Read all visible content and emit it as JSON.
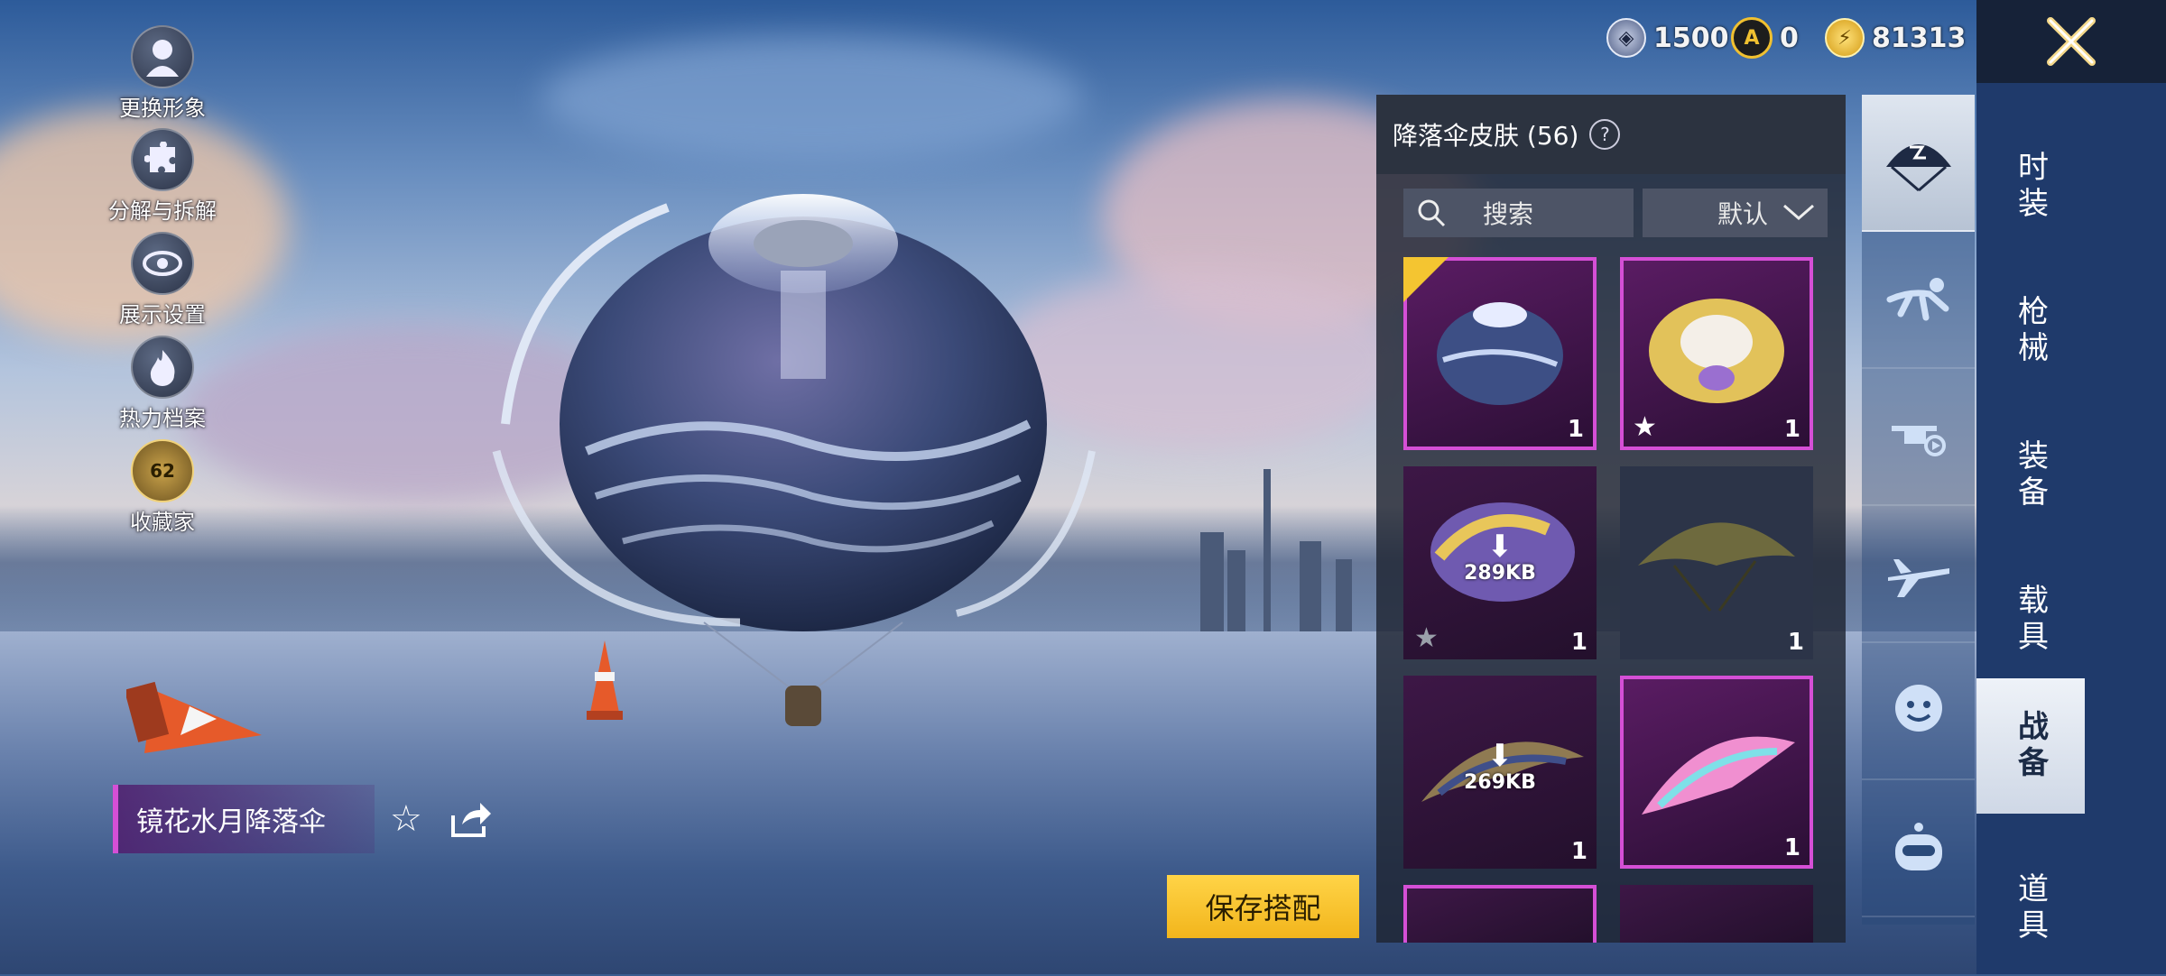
{
  "side_menu": [
    {
      "label": "更换形象",
      "icon": "avatar-icon"
    },
    {
      "label": "分解与拆解",
      "icon": "puzzle-icon"
    },
    {
      "label": "展示设置",
      "icon": "eye-icon"
    },
    {
      "label": "热力档案",
      "icon": "flame-icon"
    },
    {
      "label": "收藏家",
      "icon": "collector-badge-icon",
      "level": "62"
    }
  ],
  "currency": [
    {
      "icon": "silver-coin-icon",
      "value": "1500"
    },
    {
      "icon": "ag-coin-icon",
      "value": "0"
    },
    {
      "icon": "bp-coin-icon",
      "value": "81313"
    }
  ],
  "panel": {
    "title": "降落伞皮肤 (56)",
    "search_placeholder": "搜索",
    "sort_label": "默认"
  },
  "items": [
    {
      "count": "1",
      "selected": true,
      "favorite": false
    },
    {
      "count": "1",
      "selected": false,
      "favorite": true
    },
    {
      "count": "1",
      "download_size": "289KB",
      "favorite": true
    },
    {
      "count": "1"
    },
    {
      "count": "1",
      "download_size": "269KB"
    },
    {
      "count": "1"
    }
  ],
  "categories": [
    "parachute-icon",
    "skydive-icon",
    "drone-icon",
    "plane-icon",
    "emote-icon",
    "robot-icon"
  ],
  "tabs": [
    "时装",
    "枪械",
    "装备",
    "载具",
    "战备",
    "道具"
  ],
  "active_tab": "战备",
  "selected_item_name": "镜花水月降落伞",
  "save_button": "保存搭配",
  "colors": {
    "epic": "#d54fd6",
    "gold": "#f4c531"
  }
}
